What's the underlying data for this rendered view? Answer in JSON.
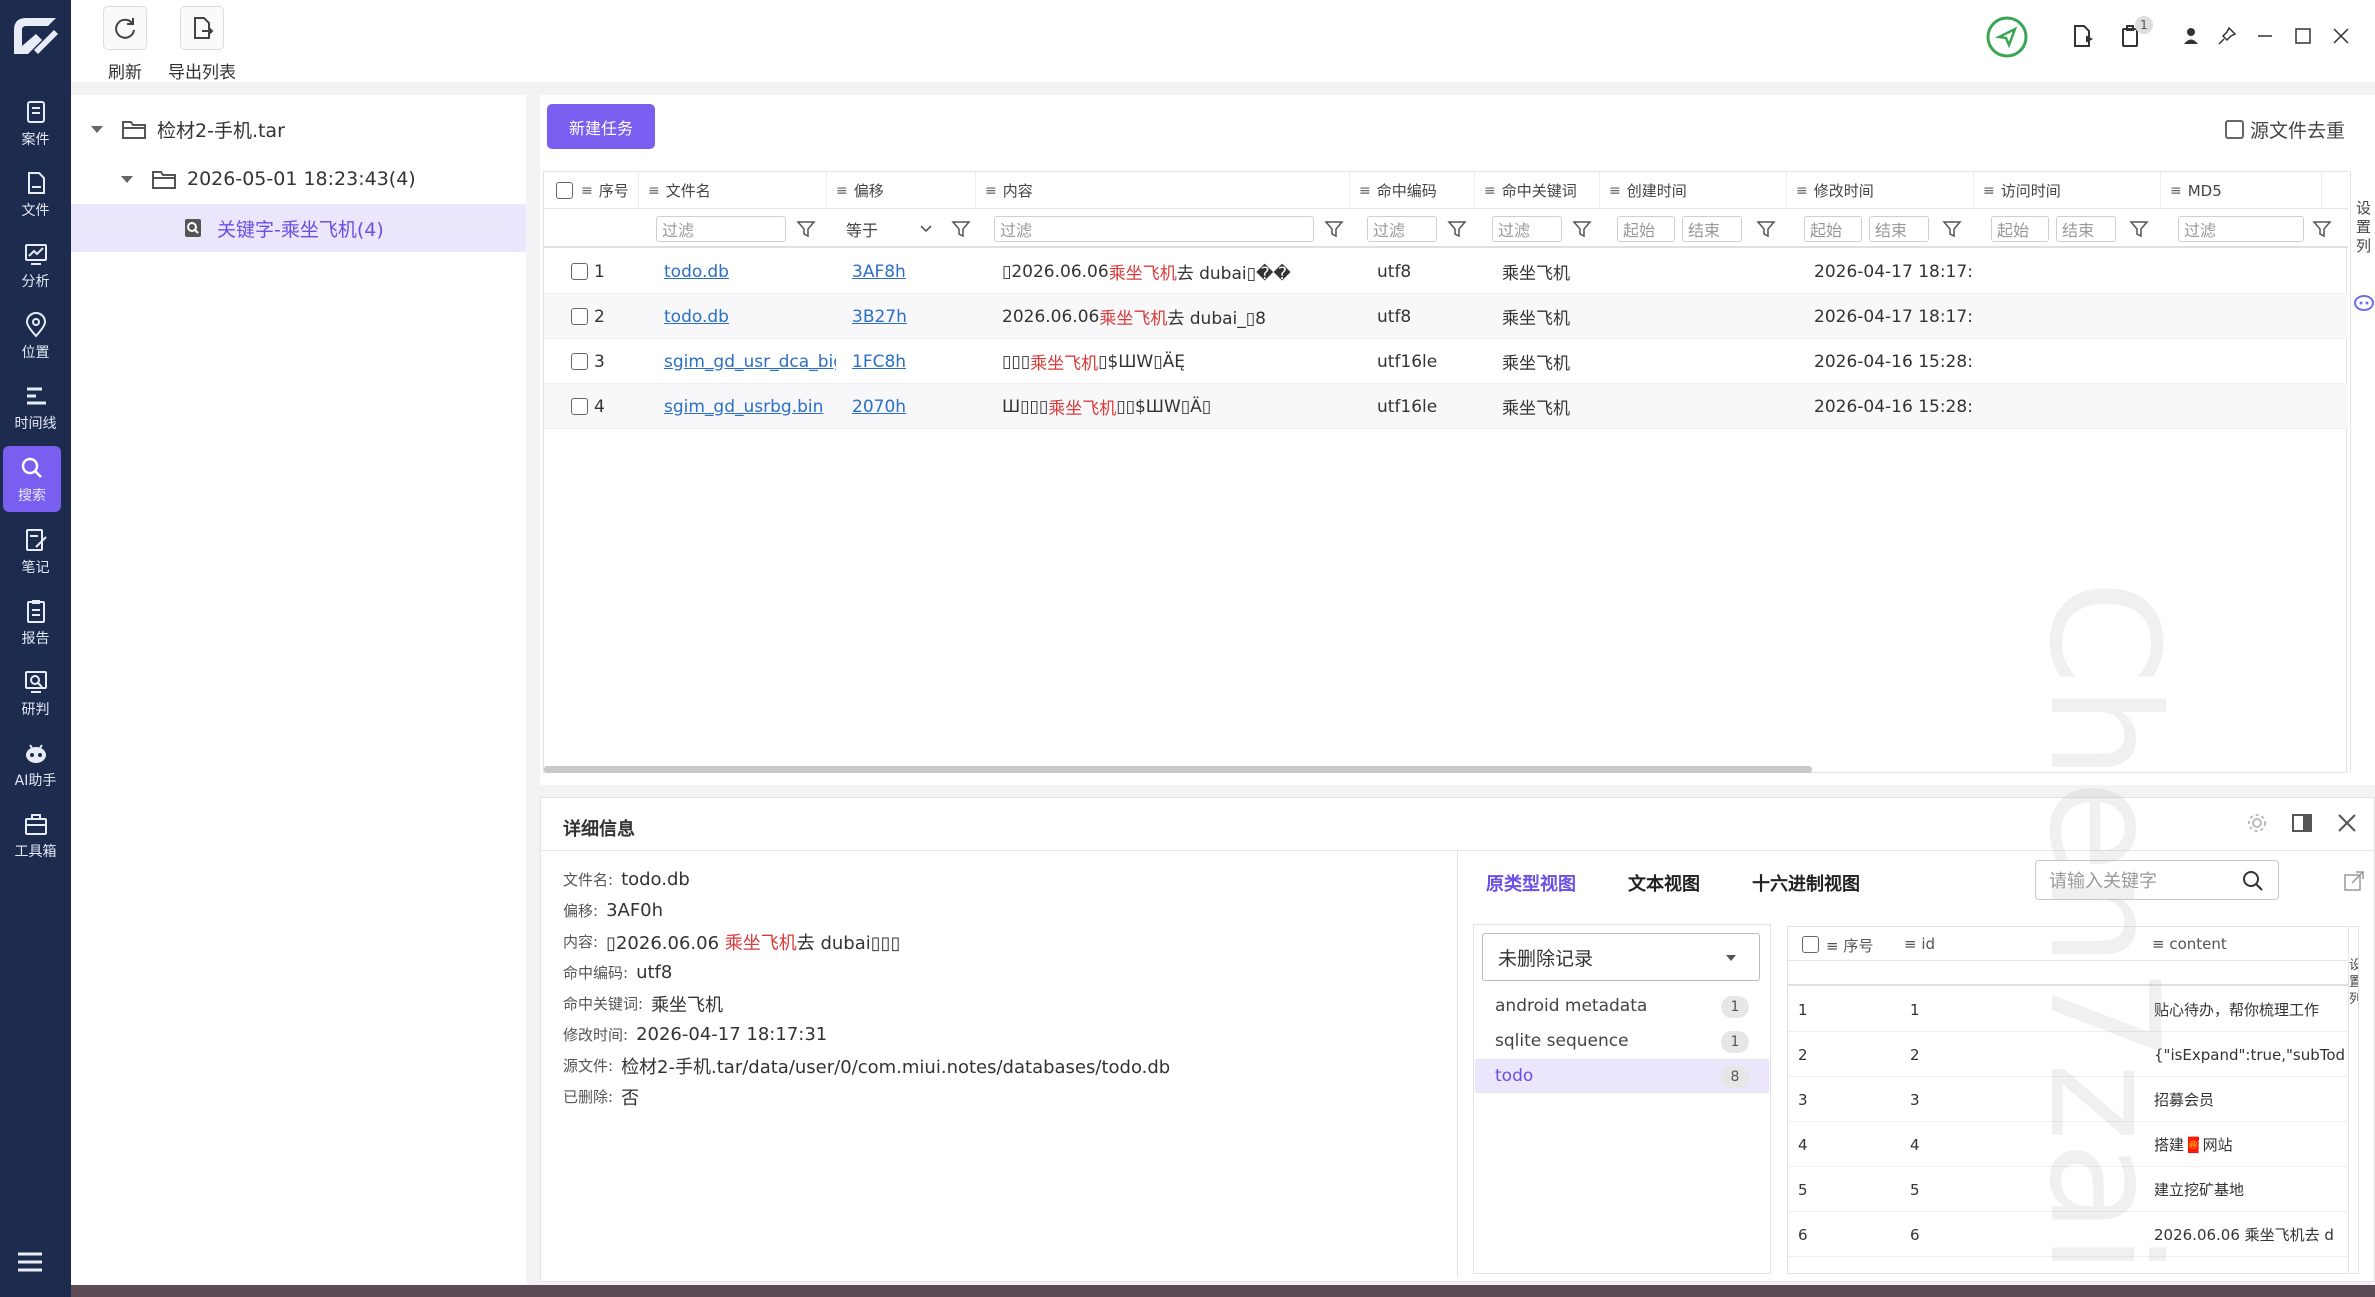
{
  "nav": {
    "items": [
      "案件",
      "文件",
      "分析",
      "位置",
      "时间线",
      "搜索",
      "笔记",
      "报告",
      "研判",
      "AI助手",
      "工具箱"
    ],
    "active_index": 5
  },
  "toolbar": {
    "refresh_label": "刷新",
    "export_label": "导出列表",
    "notification_count": "1"
  },
  "tree": {
    "root": "检材2-手机.tar",
    "child": "2026-05-01 18:23:43(4)",
    "leaf": "关键字-乘坐飞机(4)"
  },
  "main": {
    "new_task_label": "新建任务",
    "dedup_label": "源文件去重",
    "columns": [
      "序号",
      "文件名",
      "偏移",
      "内容",
      "命中编码",
      "命中关键词",
      "创建时间",
      "修改时间",
      "访问时间",
      "MD5"
    ],
    "filters": {
      "text": "过滤",
      "equals": "等于",
      "start": "起始",
      "end": "结束"
    },
    "settings_tab": "设置列",
    "rows": [
      {
        "idx": "1",
        "file": "todo.db",
        "offset": "3AF8h",
        "pre": "▯2026.06.06 ",
        "hit": "乘坐飞机",
        "post": "去 dubai▯��",
        "enc": "utf8",
        "kw": "乘坐飞机",
        "mtime": "2026-04-17 18:17:..."
      },
      {
        "idx": "2",
        "file": "todo.db",
        "offset": "3B27h",
        "pre": "2026.06.06 ",
        "hit": "乘坐飞机",
        "post": "去 dubai_▯8",
        "enc": "utf8",
        "kw": "乘坐飞机",
        "mtime": "2026-04-17 18:17:..."
      },
      {
        "idx": "3",
        "file": "sgim_gd_usr_dca_bigra",
        "offset": "1FC8h",
        "pre": "▯▯▯",
        "hit": "乘坐飞机",
        "post": " ▯$ШW▯ÄĘ",
        "enc": "utf16le",
        "kw": "乘坐飞机",
        "mtime": "2026-04-16 15:28:..."
      },
      {
        "idx": "4",
        "file": "sgim_gd_usrbg.bin",
        "offset": "2070h",
        "pre": "Ш▯▯▯",
        "hit": "乘坐飞机",
        "post": "▯▯$ШW▯Ä▯",
        "enc": "utf16le",
        "kw": "乘坐飞机",
        "mtime": "2026-04-16 15:28:..."
      }
    ]
  },
  "detail": {
    "title": "详细信息",
    "props": [
      {
        "label": "文件名:",
        "value": "todo.db"
      },
      {
        "label": "偏移:",
        "value": "3AF0h"
      },
      {
        "label": "内容:",
        "value_pre": "▯2026.06.06 ",
        "value_hit": "乘坐飞机",
        "value_post": "去 dubai▯▯▯"
      },
      {
        "label": "命中编码:",
        "value": "utf8"
      },
      {
        "label": "命中关键词:",
        "value": "乘坐飞机"
      },
      {
        "label": "修改时间:",
        "value": "2026-04-17 18:17:31"
      },
      {
        "label": "源文件:",
        "value": "检材2-手机.tar/data/user/0/com.miui.notes/databases/todo.db"
      },
      {
        "label": "已删除:",
        "value": "否"
      }
    ],
    "tabs": [
      "原类型视图",
      "文本视图",
      "十六进制视图"
    ],
    "search_placeholder": "请输入关键字",
    "record_filter": "未删除记录",
    "tables": [
      {
        "name": "android metadata",
        "count": "1"
      },
      {
        "name": "sqlite sequence",
        "count": "1"
      },
      {
        "name": "todo",
        "count": "8"
      }
    ],
    "grid_columns": [
      "序号",
      "id",
      "content"
    ],
    "settings_tab": "设置列",
    "grid_rows": [
      {
        "seq": "1",
        "id": "1",
        "content": "贴心待办，帮你梳理工作"
      },
      {
        "seq": "2",
        "id": "2",
        "content": "{\"isExpand\":true,\"subTod"
      },
      {
        "seq": "3",
        "id": "3",
        "content": "招募会员"
      },
      {
        "seq": "4",
        "id": "4",
        "content": "搭建🧧网站"
      },
      {
        "seq": "5",
        "id": "5",
        "content": "建立挖矿基地"
      },
      {
        "seq": "6",
        "id": "6",
        "content": "2026.06.06 乘坐飞机去 d"
      }
    ]
  },
  "watermark": "Chen7zai"
}
